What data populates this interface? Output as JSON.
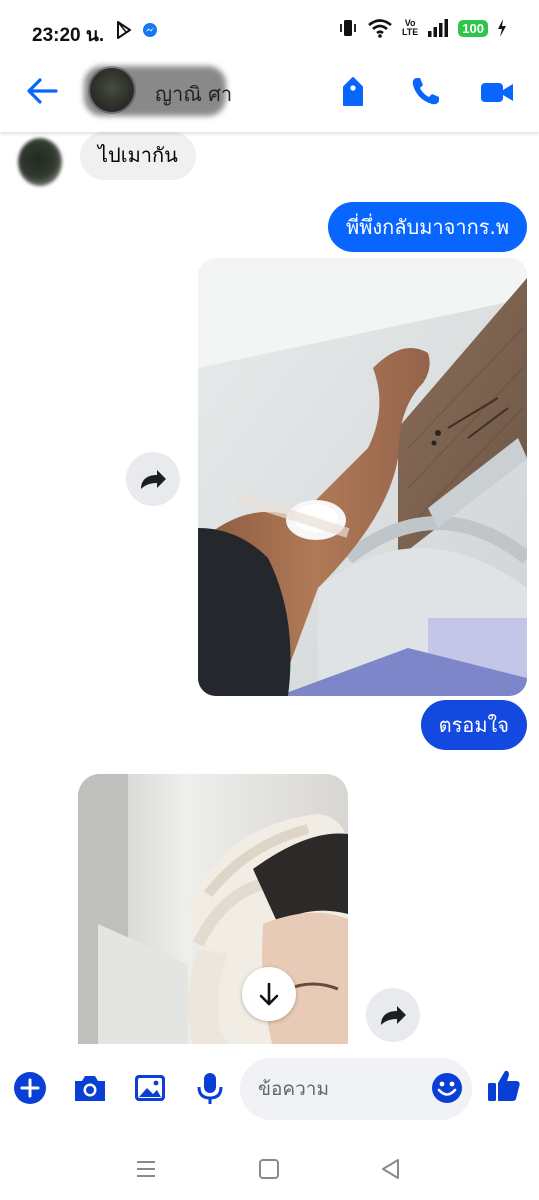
{
  "status_bar": {
    "time": "23:20 น.",
    "volte_top": "Vo",
    "volte_bottom": "LTE",
    "battery": "100"
  },
  "header": {
    "contact_name": "ญาณิ ศา",
    "icons": [
      "back-arrow-icon",
      "tag-icon",
      "phone-icon",
      "video-camera-icon"
    ],
    "accent": "#0866ff"
  },
  "messages": [
    {
      "direction": "received",
      "type": "text",
      "text": "ไปเมากัน"
    },
    {
      "direction": "sent",
      "type": "text",
      "text": "พี่พึ่งกลับมาจากร.พ"
    },
    {
      "direction": "sent",
      "type": "image",
      "alt_icon": "photo-arm-bandage"
    },
    {
      "direction": "sent",
      "type": "text",
      "text": "ตรอมใจ"
    },
    {
      "direction": "received",
      "type": "image",
      "alt_icon": "photo-towel-head"
    }
  ],
  "composer": {
    "placeholder": "ข้อความ",
    "icons": [
      "plus-icon",
      "camera-icon",
      "gallery-icon",
      "microphone-icon",
      "emoji-icon",
      "thumbs-up-icon"
    ]
  },
  "colors": {
    "bubble_sent": "#0866ff",
    "bubble_sent_deep": "#1449e0",
    "bubble_received": "#f0f0f2",
    "icon_blue": "#0a3fd6"
  }
}
